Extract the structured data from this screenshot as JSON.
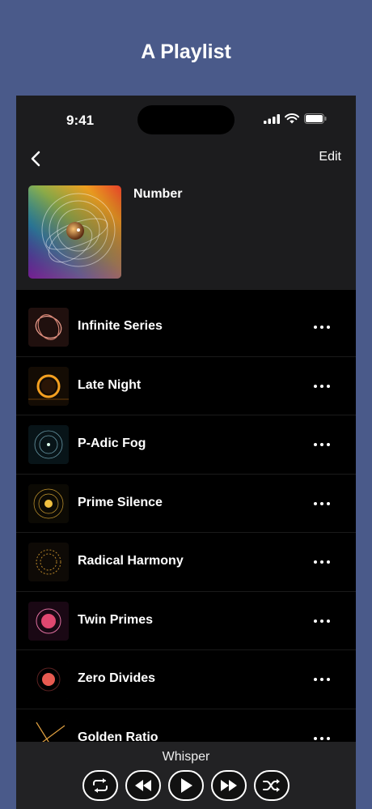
{
  "page": {
    "title": "A Playlist"
  },
  "status_bar": {
    "time": "9:41"
  },
  "nav": {
    "edit_label": "Edit"
  },
  "album": {
    "title": "Number"
  },
  "tracks": [
    {
      "name": "Infinite Series"
    },
    {
      "name": "Late Night"
    },
    {
      "name": "P-Adic Fog"
    },
    {
      "name": "Prime Silence"
    },
    {
      "name": "Radical Harmony"
    },
    {
      "name": "Twin Primes"
    },
    {
      "name": "Zero Divides"
    },
    {
      "name": "Golden Ratio"
    }
  ],
  "player": {
    "now_playing": "Whisper",
    "controls": [
      "repeat-icon",
      "rewind-icon",
      "play-icon",
      "fast-forward-icon",
      "shuffle-icon"
    ]
  },
  "colors": {
    "background": "#4a5a8a",
    "surface": "#1c1c1e",
    "list_bg": "#000000"
  }
}
